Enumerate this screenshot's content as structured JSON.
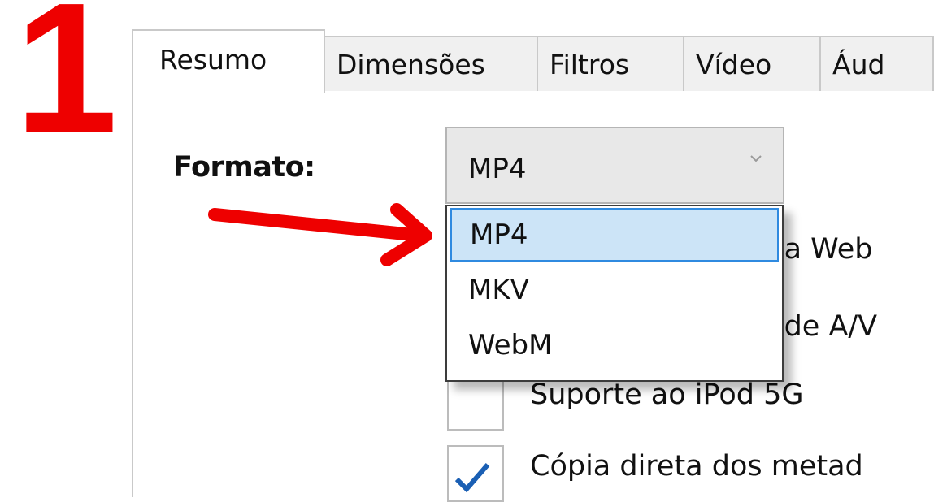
{
  "step_number": "1",
  "tabs": [
    {
      "label": "Resumo",
      "active": true
    },
    {
      "label": "Dimensões",
      "active": false
    },
    {
      "label": "Filtros",
      "active": false
    },
    {
      "label": "Vídeo",
      "active": false
    },
    {
      "label": "Áud",
      "active": false
    }
  ],
  "format": {
    "label": "Formato:",
    "selected_value": "MP4",
    "options": [
      "MP4",
      "MKV",
      "WebM"
    ],
    "highlighted_option": "MP4"
  },
  "options_partial": [
    {
      "text": "a a Web"
    },
    {
      "text": "a de A/V"
    },
    {
      "text": "Suporte ao iPod 5G",
      "checked": false
    },
    {
      "text": "Cópia direta dos metad",
      "checked": true
    }
  ],
  "colors": {
    "step_number": "#ee0000",
    "arrow": "#ee0000",
    "selection_bg": "#cce4f7",
    "selection_border": "#2f8ae0"
  },
  "icons": {
    "dropdown_arrow": "chevron-down-icon",
    "pointer": "red-arrow-annotation",
    "checkmark": "checkmark-icon"
  }
}
